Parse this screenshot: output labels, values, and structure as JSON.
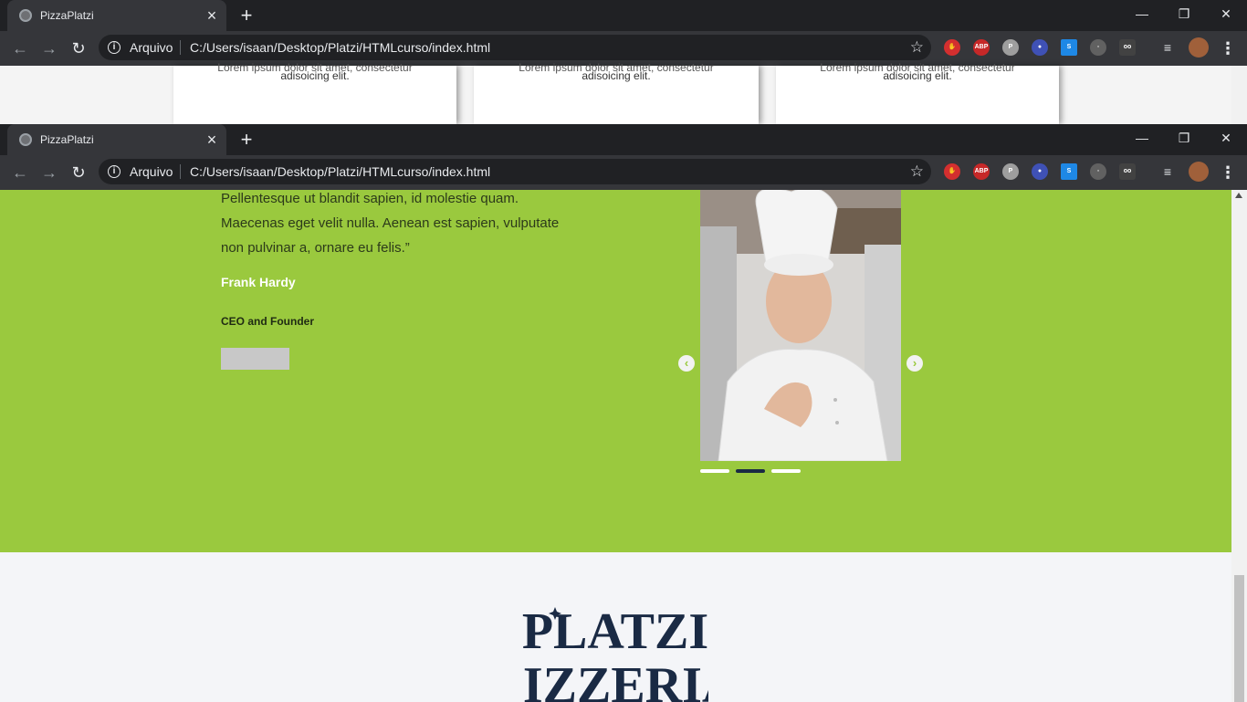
{
  "windows": [
    {
      "tab": {
        "title": "PizzaPlatzi"
      },
      "address": {
        "scheme": "Arquivo",
        "url": "C:/Users/isaan/Desktop/Platzi/HTMLcurso/index.html"
      }
    },
    {
      "tab": {
        "title": "PizzaPlatzi"
      },
      "address": {
        "scheme": "Arquivo",
        "url": "C:/Users/isaan/Desktop/Platzi/HTMLcurso/index.html"
      }
    }
  ],
  "cards": [
    {
      "line1": "Lorem ipsum dolor sit amet, consectetur",
      "line2": "adisoicing elit."
    },
    {
      "line1": "Lorem ipsum dolor sit amet, consectetur",
      "line2": "adisoicing elit."
    },
    {
      "line1": "Lorem ipsum dolor sit amet, consectetur",
      "line2": "adisoicing elit."
    }
  ],
  "testimonial": {
    "quote_lines": [
      "Pellentesque ut blandit sapien, id molestie quam.",
      "Maecenas eget velit nulla. Aenean est sapien, vulputate",
      "non pulvinar a, ornare eu felis.”"
    ],
    "author": "Frank Hardy",
    "role": "CEO and Founder"
  },
  "carousel": {
    "slides": 3,
    "active_index": 1
  },
  "footer": {
    "logo_line1": "PLATZI",
    "logo_line2": "PIZZERIA"
  },
  "colors": {
    "brand_green": "#9ac93e",
    "navy": "#1a2a44",
    "chrome_dark": "#202124"
  },
  "icons": [
    "globe-icon",
    "close-icon",
    "plus-icon",
    "back-arrow-icon",
    "forward-arrow-icon",
    "reload-icon",
    "info-icon",
    "star-icon",
    "chevron-left-icon",
    "chevron-right-icon"
  ]
}
